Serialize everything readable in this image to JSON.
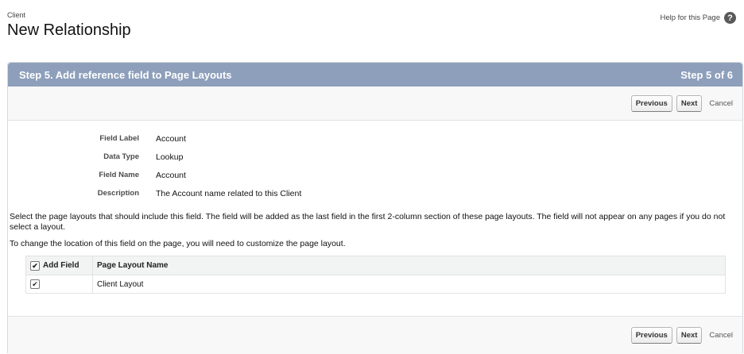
{
  "header": {
    "object_label": "Client",
    "title": "New Relationship",
    "help_link": "Help for this Page",
    "help_icon": "question-mark-icon"
  },
  "step": {
    "title": "Step 5. Add reference field to Page Layouts",
    "counter": "Step 5 of 6"
  },
  "buttons": {
    "previous": "Previous",
    "next": "Next",
    "cancel": "Cancel"
  },
  "details": [
    {
      "label": "Field Label",
      "value": "Account"
    },
    {
      "label": "Data Type",
      "value": "Lookup"
    },
    {
      "label": "Field Name",
      "value": "Account"
    },
    {
      "label": "Description",
      "value": "The Account name related to this Client"
    }
  ],
  "instructions": {
    "line1": "Select the page layouts that should include this field. The field will be added as the last field in the first 2-column section of these page layouts. The field will not appear on any pages if you do not select a layout.",
    "line2": "To change the location of this field on the page, you will need to customize the page layout."
  },
  "layout_table": {
    "headers": {
      "add": "Add Field",
      "name": "Page Layout Name"
    },
    "header_checked": true,
    "rows": [
      {
        "checked": true,
        "name": "Client Layout"
      }
    ]
  },
  "colors": {
    "step_bar": "#8d9fbb",
    "button_row_bg": "#f8f8f8"
  }
}
